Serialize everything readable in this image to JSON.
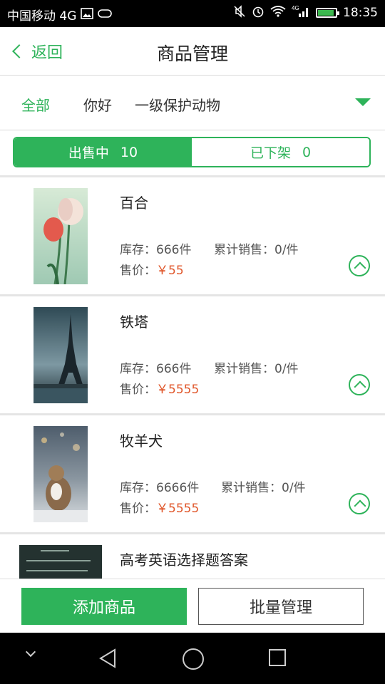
{
  "status_bar": {
    "carrier": "中国移动 4G",
    "time": "18:35",
    "network": "4G"
  },
  "header": {
    "back_label": "返回",
    "title": "商品管理"
  },
  "filters": {
    "items": [
      "全部",
      "你好",
      "一级保护动物"
    ],
    "active": "全部"
  },
  "segments": [
    {
      "label": "出售中",
      "count": "10"
    },
    {
      "label": "已下架",
      "count": "0"
    }
  ],
  "products": [
    {
      "name": "百合",
      "stock": "库存：666件",
      "sales": "累计销售：0/件",
      "price_label": "售价：",
      "price": "￥55"
    },
    {
      "name": "铁塔",
      "stock": "库存：666件",
      "sales": "累计销售：0/件",
      "price_label": "售价：",
      "price": "￥5555"
    },
    {
      "name": "牧羊犬",
      "stock": "库存：6666件",
      "sales": "累计销售：0/件",
      "price_label": "售价：",
      "price": "￥5555"
    },
    {
      "name": "高考英语选择题答案"
    }
  ],
  "actions": {
    "add": "添加商品",
    "batch": "批量管理"
  },
  "colors": {
    "accent": "#2eb35a",
    "price": "#e0572b"
  }
}
